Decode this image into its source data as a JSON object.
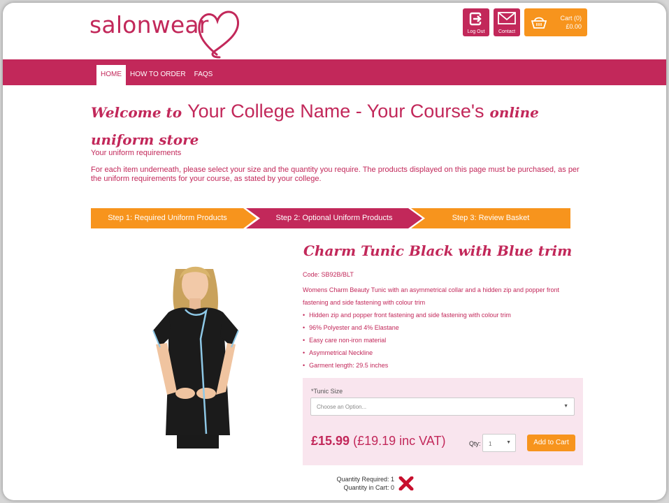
{
  "header": {
    "logo_text": "salonwear",
    "logout_label": "Log Out",
    "contact_label": "Contact",
    "cart_label": "Cart (0)",
    "cart_total": "£0.00"
  },
  "nav": {
    "items": [
      {
        "label": "HOME"
      },
      {
        "label": "HOW TO ORDER"
      },
      {
        "label": "FAQS"
      }
    ]
  },
  "welcome": {
    "prefix": "Welcome to",
    "college": "Your College Name - Your Course's",
    "suffix_line1": "online",
    "suffix_line2": "uniform store"
  },
  "requirements": {
    "title": "Your uniform requirements",
    "description": "For each item underneath, please select your size and the quantity you require. The products displayed on this page must be purchased, as per the uniform requirements for your course, as stated by your college."
  },
  "steps": [
    {
      "label": "Step 1: Required Uniform Products"
    },
    {
      "label": "Step 2: Optional Uniform Products"
    },
    {
      "label": "Step 3: Review Basket"
    }
  ],
  "product": {
    "title": "Charm Tunic Black with Blue trim",
    "code": "Code: SB92B/BLT",
    "description": "Womens Charm Beauty Tunic with an asymmetrical collar and a hidden zip and popper front fastening and side fastening with colour trim",
    "features": [
      "Hidden zip and popper front fastening and side fastening with colour trim",
      "96% Polyester and 4% Elastane",
      "Easy care non-iron material",
      "Asymmetrical Neckline",
      "Garment length: 29.5 inches"
    ],
    "size_label": "*Tunic Size",
    "size_placeholder": "Choose an Option...",
    "price": "£15.99",
    "price_vat": "(£19.19 inc VAT)",
    "qty_label": "Qty:",
    "qty_value": "1",
    "add_to_cart": "Add to Cart",
    "quantity_required": "Quantity Required: 1",
    "quantity_in_cart": "Quantity in Cart: 0"
  },
  "colors": {
    "brand_pink": "#c2285a",
    "brand_orange": "#f7941d",
    "option_bg": "#f9e5ee"
  }
}
